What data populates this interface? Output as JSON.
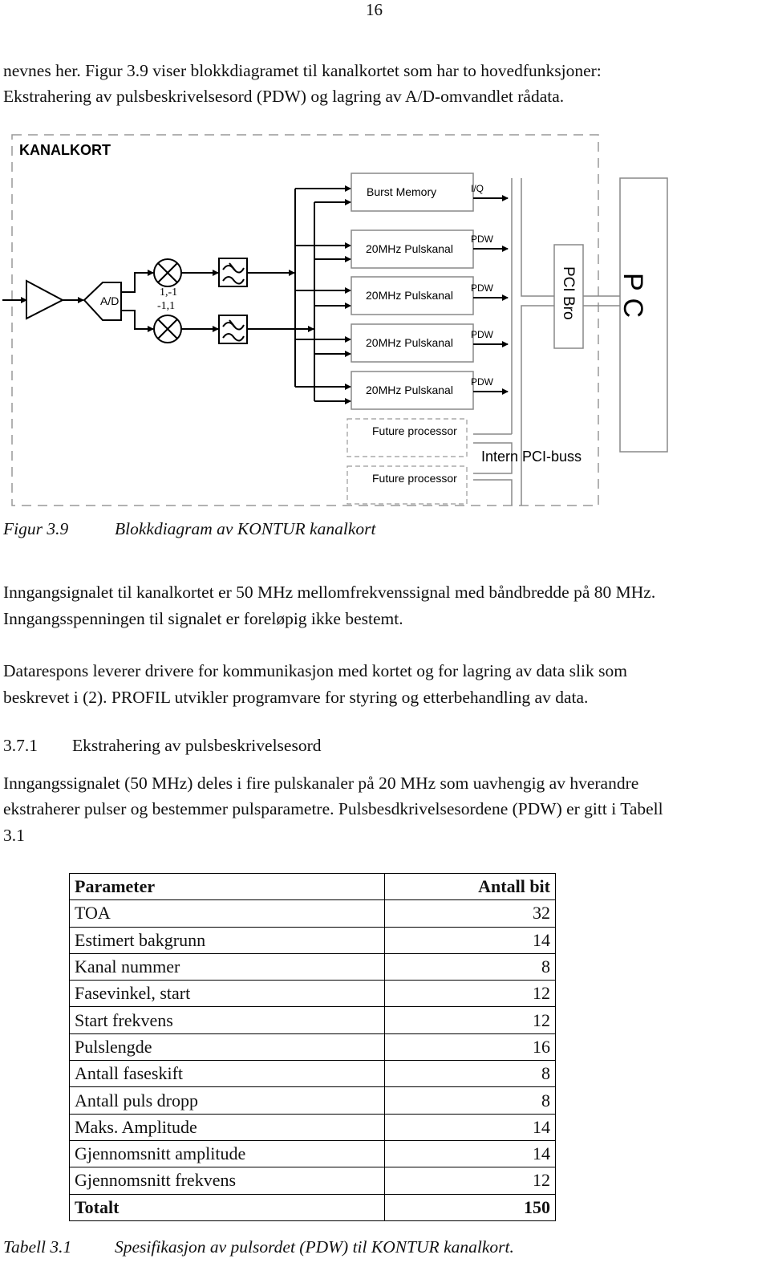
{
  "page_number": "16",
  "intro": [
    "nevnes her. Figur 3.9 viser blokkdiagramet til kanalkortet som har to hovedfunksjoner:",
    "Ekstrahering av pulsbeskrivelsesord (PDW) og lagring av A/D-omvandlet rådata."
  ],
  "diagram": {
    "frame_label": "KANALKORT",
    "ad_label": "A/D",
    "mixer_labels": [
      "1,-1",
      "-1,1"
    ],
    "blocks": [
      "Burst Memory",
      "20MHz Pulskanal",
      "20MHz Pulskanal",
      "20MHz Pulskanal",
      "20MHz Pulskanal"
    ],
    "outputs": [
      "I/Q",
      "PDW",
      "PDW",
      "PDW",
      "PDW"
    ],
    "future": [
      "Future processor",
      "Future processor"
    ],
    "bus_label": "Intern PCI-buss",
    "bridge_label": "PCI Bro",
    "pc_label": "P C"
  },
  "figure_caption": {
    "number": "Figur 3.9",
    "text": "Blokkdiagram av KONTUR kanalkort"
  },
  "paragraphs": [
    [
      "Inngangsignalet til kanalkortet er 50 MHz mellomfrekvenssignal med båndbredde på 80 MHz.",
      "Inngangsspenningen til signalet er foreløpig ikke bestemt."
    ],
    [
      "Datarespons leverer drivere for kommunikasjon med kortet og for lagring av data slik som",
      "beskrevet i (2). PROFIL utvikler programvare for styring og etterbehandling av data."
    ]
  ],
  "section": {
    "number": "3.7.1",
    "title": "Ekstrahering av pulsbeskrivelsesord"
  },
  "section_text": [
    "Inngangssignalet (50 MHz) deles i fire pulskanaler på 20 MHz som uavhengig av hverandre",
    "ekstraherer pulser og bestemmer pulsparametre. Pulsbesdkrivelsesordene (PDW) er gitt i Tabell",
    "3.1"
  ],
  "table": {
    "headers": [
      "Parameter",
      "Antall bit"
    ],
    "rows": [
      [
        "TOA",
        "32"
      ],
      [
        "Estimert bakgrunn",
        "14"
      ],
      [
        "Kanal nummer",
        "8"
      ],
      [
        "Fasevinkel, start",
        "12"
      ],
      [
        "Start frekvens",
        "12"
      ],
      [
        "Pulslengde",
        "16"
      ],
      [
        "Antall faseskift",
        "8"
      ],
      [
        "Antall puls dropp",
        "8"
      ],
      [
        "Maks. Amplitude",
        "14"
      ],
      [
        "Gjennomsnitt amplitude",
        "14"
      ],
      [
        "Gjennomsnitt frekvens",
        "12"
      ]
    ],
    "total": [
      "Totalt",
      "150"
    ]
  },
  "table_caption": {
    "number": "Tabell 3.1",
    "text": "Spesifikasjon av pulsordet (PDW) til KONTUR kanalkort."
  }
}
